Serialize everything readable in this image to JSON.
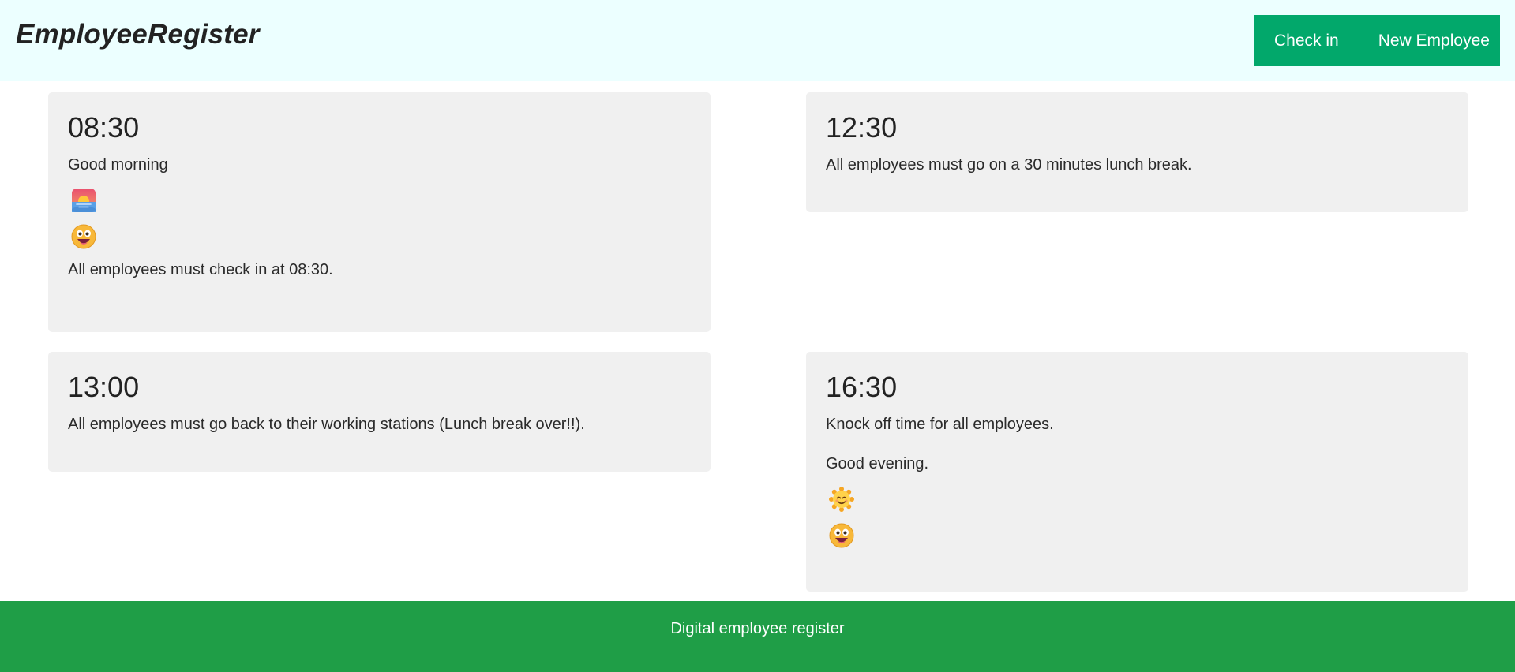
{
  "header": {
    "brand": "EmployeeRegister",
    "nav": {
      "check_in": "Check in",
      "new_employee": "New Employee"
    }
  },
  "schedule": [
    {
      "time": "08:30",
      "greeting": "Good morning",
      "icons": [
        "sunrise-icon",
        "grinning-face-icon"
      ],
      "message": "All employees must check in at 08:30."
    },
    {
      "time": "12:30",
      "message": "All employees must go on a 30 minutes lunch break."
    },
    {
      "time": "13:00",
      "message": "All employees must go back to their working stations (Lunch break over!!)."
    },
    {
      "time": "16:30",
      "message": "Knock off time for all employees.",
      "greeting": "Good evening.",
      "icons": [
        "sun-with-face-icon",
        "grinning-face-icon"
      ]
    }
  ],
  "footer": {
    "text": "Digital employee register"
  },
  "colors": {
    "header_bg": "#ecffff",
    "nav_bg": "#02a86b",
    "card_bg": "#f0f0f0",
    "footer_bg": "#1f9e47"
  }
}
